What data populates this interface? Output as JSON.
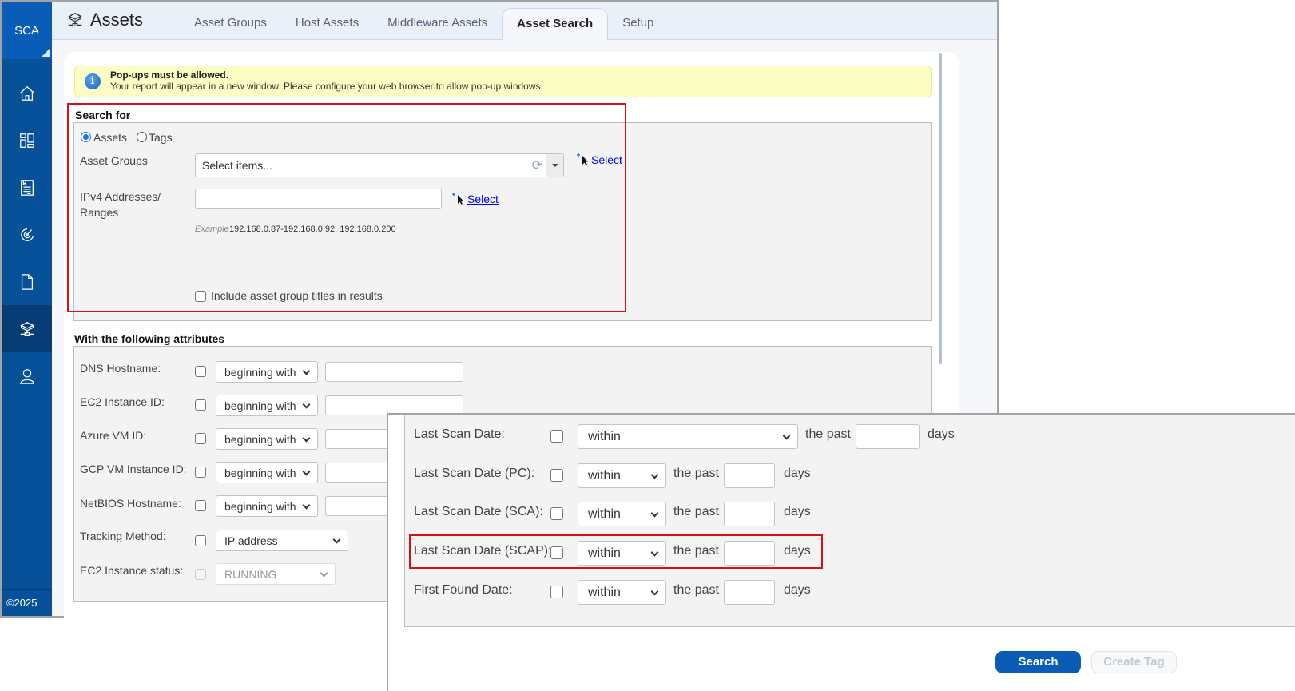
{
  "sidebar": {
    "brand": "SCA",
    "items": [
      {
        "name": "home",
        "icon": "home-icon"
      },
      {
        "name": "dashboard",
        "icon": "dashboard-icon"
      },
      {
        "name": "reports",
        "icon": "report-icon"
      },
      {
        "name": "scans",
        "icon": "scan-gauge-icon"
      },
      {
        "name": "documents",
        "icon": "document-icon"
      },
      {
        "name": "assets",
        "icon": "assets-network-icon",
        "active": true
      },
      {
        "name": "users",
        "icon": "user-icon"
      }
    ],
    "copyright": "©2025"
  },
  "header": {
    "title": "Assets",
    "tabs": [
      {
        "label": "Asset Groups"
      },
      {
        "label": "Host Assets"
      },
      {
        "label": "Middleware Assets"
      },
      {
        "label": "Asset Search",
        "active": true
      },
      {
        "label": "Setup"
      }
    ]
  },
  "alert": {
    "title": "Pop-ups must be allowed.",
    "message": "Your report will appear in a new window. Please configure your web browser to allow pop-up windows."
  },
  "search_for": {
    "title": "Search for",
    "radios": [
      {
        "label": "Assets",
        "checked": true
      },
      {
        "label": "Tags",
        "checked": false
      }
    ],
    "asset_groups_label": "Asset Groups",
    "asset_groups_placeholder": "Select items...",
    "select_link": "Select",
    "ipv4_label_line1": "IPv4 Addresses/",
    "ipv4_label_line2": "Ranges",
    "ipv4_value": "",
    "example_label": "Example",
    "example_value": "192.168.0.87-192.168.0.92, 192.168.0.200",
    "include_titles_label": "Include asset group titles in results",
    "include_titles_checked": false
  },
  "attributes": {
    "title": "With the following attributes",
    "rows": [
      {
        "label": "DNS Hostname:",
        "operator": "beginning with",
        "value": ""
      },
      {
        "label": "EC2 Instance ID:",
        "operator": "beginning with",
        "value": ""
      },
      {
        "label": "Azure VM ID:",
        "operator": "beginning with",
        "value": ""
      },
      {
        "label": "GCP VM Instance ID:",
        "operator": "beginning with",
        "value": ""
      },
      {
        "label": "NetBIOS Hostname:",
        "operator": "beginning with",
        "value": ""
      },
      {
        "label": "Tracking Method:",
        "operator": "IP address"
      },
      {
        "label": "EC2 Instance status:",
        "operator": "RUNNING",
        "disabled": true
      }
    ]
  },
  "date_filters": {
    "rows": [
      {
        "label": "Last Scan Date:",
        "operator": "within",
        "prefix": "the past",
        "value": "",
        "suffix": "days"
      },
      {
        "label": "Last Scan Date (PC):",
        "operator": "within",
        "prefix": "the past",
        "value": "",
        "suffix": "days"
      },
      {
        "label": "Last Scan Date (SCA):",
        "operator": "within",
        "prefix": "the past",
        "value": "",
        "suffix": "days"
      },
      {
        "label": "Last Scan Date (SCAP):",
        "operator": "within",
        "prefix": "the past",
        "value": "",
        "suffix": "days",
        "highlighted": true
      },
      {
        "label": "First Found Date:",
        "operator": "within",
        "prefix": "the past",
        "value": "",
        "suffix": "days"
      }
    ]
  },
  "actions": {
    "search": "Search",
    "create_tag": "Create Tag"
  },
  "colors": {
    "sidebar": "#07519a",
    "brand": "#0a5db7",
    "primary_button": "#0b5cb5",
    "highlight_border": "#d9101b",
    "alert_bg": "#fbfdc3"
  }
}
